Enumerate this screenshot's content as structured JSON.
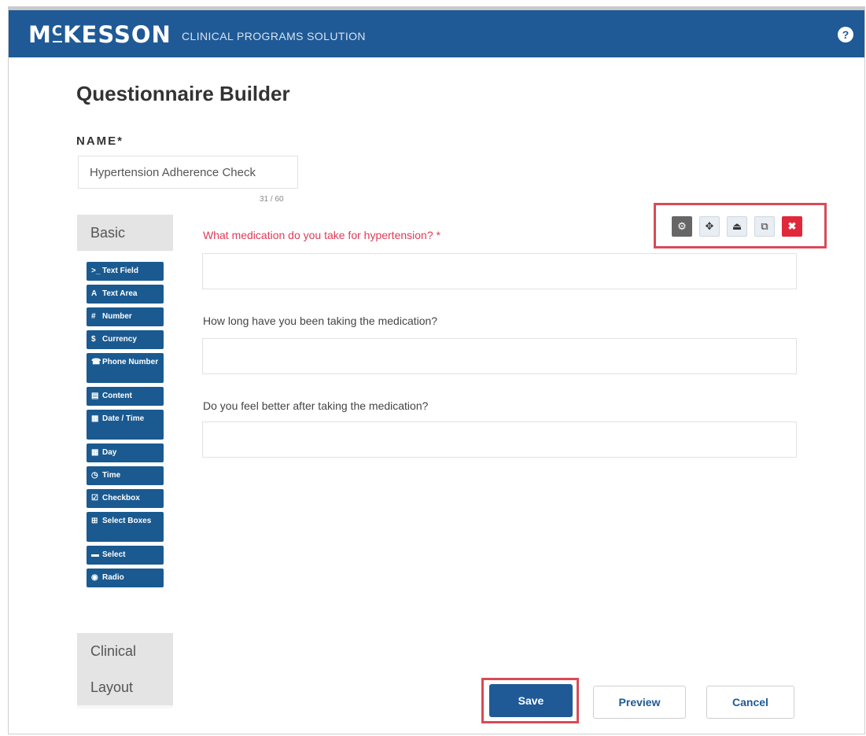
{
  "header": {
    "logo_main_a": "M",
    "logo_small_c": "C",
    "logo_main_b": "KESSON",
    "tagline": "CLINICAL PROGRAMS SOLUTION",
    "help_icon": "?"
  },
  "page": {
    "title": "Questionnaire Builder",
    "name_label": "NAME*",
    "name_value": "Hypertension Adherence Check",
    "char_count": "31 / 60"
  },
  "sidebar": {
    "basic_label": "Basic",
    "clinical_label": "Clinical",
    "layout_label": "Layout",
    "components": [
      {
        "icon": ">_",
        "label": "Text Field"
      },
      {
        "icon": "A",
        "label": "Text Area"
      },
      {
        "icon": "#",
        "label": "Number"
      },
      {
        "icon": "$",
        "label": "Currency"
      },
      {
        "icon": "☎",
        "label": "Phone Number"
      },
      {
        "icon": "▤",
        "label": "Content"
      },
      {
        "icon": "▦",
        "label": "Date / Time"
      },
      {
        "icon": "▦",
        "label": "Day"
      },
      {
        "icon": "◷",
        "label": "Time"
      },
      {
        "icon": "☑",
        "label": "Checkbox"
      },
      {
        "icon": "⊞",
        "label": "Select Boxes"
      },
      {
        "icon": "▬",
        "label": "Select"
      },
      {
        "icon": "◉",
        "label": "Radio"
      }
    ]
  },
  "form": {
    "questions": [
      {
        "label": "What medication do you take for hypertension? *",
        "required": true
      },
      {
        "label": "How long have you been taking the medication?",
        "required": false
      },
      {
        "label": "Do you feel better after taking the medication?",
        "required": false
      }
    ]
  },
  "toolbar": {
    "settings_icon": "⚙",
    "move_icon": "✥",
    "upload_icon": "⏏",
    "copy_icon": "⧉",
    "remove_icon": "✖"
  },
  "actions": {
    "save_label": "Save",
    "preview_label": "Preview",
    "cancel_label": "Cancel"
  }
}
